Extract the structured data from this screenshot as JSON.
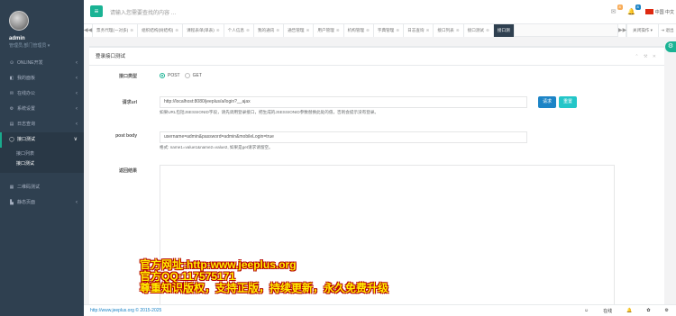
{
  "profile": {
    "name": "admin",
    "role": "管理员,部门管理员 ▾"
  },
  "sidebar": {
    "items": [
      {
        "icon": "⊙",
        "label": "ONLINE开发",
        "arrow": "‹"
      },
      {
        "icon": "◧",
        "label": "我的面板",
        "arrow": "‹"
      },
      {
        "icon": "✉",
        "label": "在线办公",
        "arrow": "‹"
      },
      {
        "icon": "⚙",
        "label": "系统设置",
        "arrow": "‹"
      },
      {
        "icon": "▤",
        "label": "日志查询",
        "arrow": "‹"
      },
      {
        "icon": "◯",
        "label": "接口测试",
        "arrow": "∨"
      }
    ],
    "sub_items": [
      "接口列表",
      "接口测试"
    ],
    "items_after": [
      {
        "icon": "▦",
        "label": "二维码测试",
        "arrow": ""
      },
      {
        "icon": "▙",
        "label": "静态页面",
        "arrow": "‹"
      }
    ]
  },
  "topbar": {
    "menu_icon": "≡",
    "search_placeholder": "请输入您需要查找的内容 …",
    "msg_badge": "8",
    "bell_badge": "8",
    "language": "中国 中文"
  },
  "tabs": {
    "prev": "◀◀",
    "next": "▶▶",
    "items": [
      {
        "label": "票务代理(一对多)",
        "active": false
      },
      {
        "label": "组织结构(树结构)",
        "active": false
      },
      {
        "label": "课程表单(单表)",
        "active": false
      },
      {
        "label": "个人信息",
        "active": false
      },
      {
        "label": "我的通讯",
        "active": false
      },
      {
        "label": "通告管理",
        "active": false
      },
      {
        "label": "用户管理",
        "active": false
      },
      {
        "label": "机构管理",
        "active": false
      },
      {
        "label": "字典管理",
        "active": false
      },
      {
        "label": "日志查询",
        "active": false
      },
      {
        "label": "接口列表",
        "active": false
      },
      {
        "label": "接口测试",
        "active": false
      },
      {
        "label": "接口测",
        "active": true
      }
    ],
    "close_label": "关闭操作 ▾",
    "exit_label": "⇥ 退出"
  },
  "panel": {
    "title": "登录接口测试",
    "tools": "⌃ ⚒ ✕",
    "method_label": "接口类型",
    "method_options": [
      {
        "label": "POST",
        "selected": true
      },
      {
        "label": "GET",
        "selected": false
      }
    ],
    "url_label": "请求url",
    "url_value": "http://localhost:8080/jeeplus/a/login?__ajax",
    "url_help": "如果URL包括JSESSIONID字段，请先调用登录接口，把生成的JSESSIONID参数替换此处的值，否则会提示没有登录。",
    "request_button": "请求",
    "reset_button": "重置",
    "body_label": "post body",
    "body_value": "username=admin&password=admin&mobileLogin=true",
    "body_help": "格式: name1=value1&name2=value2, 如果是get请求请留空。",
    "result_label": "返回结果",
    "result_value": ""
  },
  "footer": {
    "copyright": "http://www.jeeplus.org © 2015-2025",
    "tools": [
      "☺",
      "在线",
      "🔔",
      "✿",
      "⚙"
    ]
  },
  "watermark": [
    "官方网址:http:www.jeeplus.org",
    "官方QQ:117575171",
    "尊重知识版权，支持正版，持续更新，永久免费升级"
  ]
}
